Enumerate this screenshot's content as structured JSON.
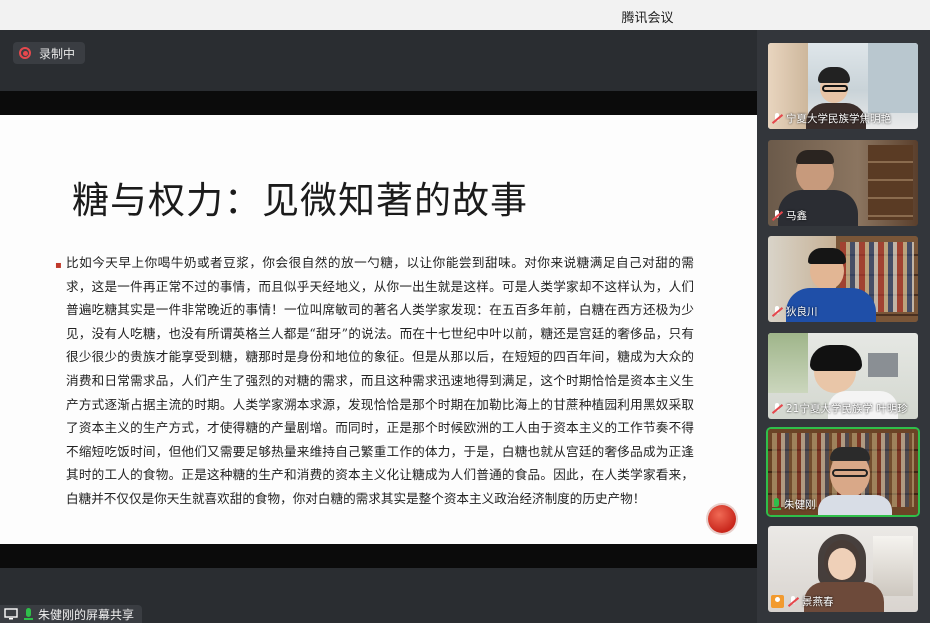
{
  "app": {
    "title": "腾讯会议"
  },
  "recording": {
    "label": "录制中"
  },
  "slide": {
    "title": "糖与权力：见微知著的故事",
    "paragraph": "比如今天早上你喝牛奶或者豆浆，你会很自然的放一勺糖，以让你能尝到甜味。对你来说糖满足自己对甜的需求，这是一件再正常不过的事情，而且似乎天经地义，从你一出生就是这样。可是人类学家却不这样认为，人们普遍吃糖其实是一件非常晚近的事情！一位叫席敏司的著名人类学家发现：在五百多年前，白糖在西方还极为少见，没有人吃糖，也没有所谓英格兰人都是“甜牙”的说法。而在十七世纪中叶以前，糖还是宫廷的奢侈品，只有很少很少的贵族才能享受到糖，糖那时是身份和地位的象征。但是从那以后，在短短的四百年间，糖成为大众的消费和日常需求品，人们产生了强烈的对糖的需求，而且这种需求迅速地得到满足，这个时期恰恰是资本主义生产方式逐渐占据主流的时期。人类学家溯本求源，发现恰恰是那个时期在加勒比海上的甘蔗种植园利用黑奴采取了资本主义的生产方式，才使得糖的产量剧增。而同时，正是那个时候欧洲的工人由于资本主义的工作节奏不得不缩短吃饭时间，但他们又需要足够热量来维持自己繁重工作的体力，于是，白糖也就从宫廷的奢侈品成为正逢其时的工人的食物。正是这种糖的生产和消费的资本主义化让糖成为人们普通的食品。因此，在人类学家看来，白糖并不仅仅是你天生就喜欢甜的食物，你对白糖的需求其实是整个资本主义政治经济制度的历史产物！"
  },
  "screen_share": {
    "label": "朱健刚的屏幕共享"
  },
  "participants": [
    {
      "name": "宁夏大学民族学焦明艳",
      "mic": "muted",
      "active": false
    },
    {
      "name": "马鑫",
      "mic": "muted",
      "active": false
    },
    {
      "name": "狄良川",
      "mic": "muted",
      "active": false
    },
    {
      "name": "21宁夏大学民族学 叶明珍",
      "mic": "muted",
      "active": false
    },
    {
      "name": "朱健刚",
      "mic": "on",
      "active": true
    },
    {
      "name": "景燕春",
      "mic": "muted",
      "active": false
    }
  ],
  "colors": {
    "accent_green": "#2fbf4a",
    "record_red": "#e5484d"
  }
}
